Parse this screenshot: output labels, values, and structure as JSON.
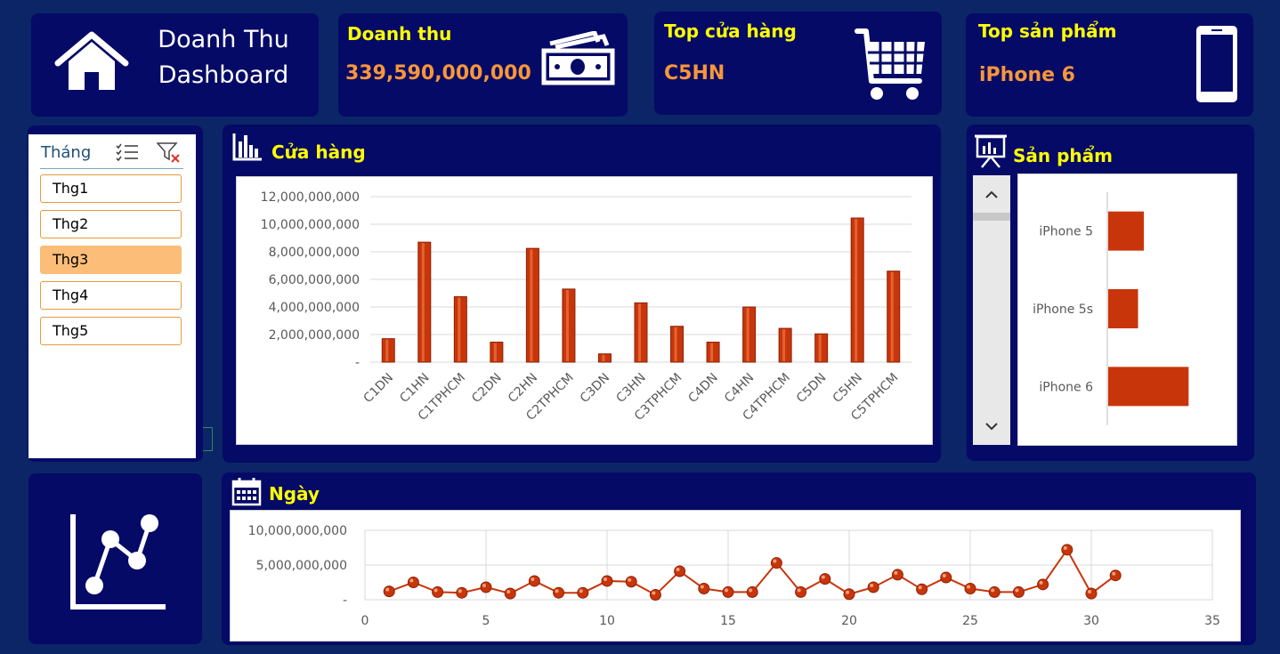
{
  "header": {
    "title_line1": "Doanh Thu",
    "title_line2": "Dashboard"
  },
  "kpis": {
    "revenue": {
      "label": "Doanh thu",
      "value": "339,590,000,000"
    },
    "top_store": {
      "label": "Top cửa hàng",
      "value": "C5HN"
    },
    "top_product": {
      "label": "Top sản phẩm",
      "value": "iPhone 6"
    }
  },
  "slicer": {
    "header": "Tháng",
    "items": [
      {
        "label": "Thg1",
        "selected": false
      },
      {
        "label": "Thg2",
        "selected": false
      },
      {
        "label": "Thg3",
        "selected": true
      },
      {
        "label": "Thg4",
        "selected": false
      },
      {
        "label": "Thg5",
        "selected": false
      }
    ]
  },
  "panels": {
    "store": "Cửa hàng",
    "product": "Sản phẩm",
    "day": "Ngày"
  },
  "colors": {
    "bar": "#c9350a",
    "line": "#c9350a",
    "background": "#0b2566",
    "card": "#050a66",
    "title": "#ffff00",
    "value": "#f7963a"
  },
  "icons": {
    "header": "home-icon",
    "revenue": "money-icon",
    "top_store": "shopping-cart-icon",
    "top_product": "smartphone-icon",
    "store_panel": "bar-chart-icon",
    "product_panel": "presentation-icon",
    "day_panel": "calendar-icon",
    "trend": "line-chart-icon"
  },
  "chart_data": [
    {
      "type": "bar",
      "categories": [
        "C1DN",
        "C1HN",
        "C1TPHCM",
        "C2DN",
        "C2HN",
        "C2TPHCM",
        "C3DN",
        "C3HN",
        "C3TPHCM",
        "C4DN",
        "C4HN",
        "C4TPHCM",
        "C5DN",
        "C5HN",
        "C5TPHCM"
      ],
      "values": [
        1700000000,
        8700000000,
        4750000000,
        1450000000,
        8250000000,
        5300000000,
        600000000,
        4300000000,
        2600000000,
        1450000000,
        4000000000,
        2450000000,
        2050000000,
        10450000000,
        6600000000
      ],
      "ylim": [
        0,
        12000000000
      ],
      "yticks": [
        "-",
        "2,000,000,000",
        "4,000,000,000",
        "6,000,000,000",
        "8,000,000,000",
        "10,000,000,000",
        "12,000,000,000"
      ],
      "grid": true,
      "legend": "none"
    },
    {
      "type": "bar",
      "orientation": "horizontal",
      "categories": [
        "iPhone 5",
        "iPhone 5s",
        "iPhone 6"
      ],
      "values": [
        43,
        36,
        97
      ],
      "xlim": [
        0,
        145
      ],
      "grid": false,
      "legend": "none"
    },
    {
      "type": "line",
      "x": [
        1,
        2,
        3,
        4,
        5,
        6,
        7,
        8,
        9,
        10,
        11,
        12,
        13,
        14,
        15,
        16,
        17,
        18,
        19,
        20,
        21,
        22,
        23,
        24,
        25,
        26,
        27,
        28,
        29,
        30,
        31
      ],
      "values": [
        1200000000,
        2500000000,
        1100000000,
        1000000000,
        1800000000,
        900000000,
        2700000000,
        1000000000,
        1000000000,
        2700000000,
        2600000000,
        700000000,
        4100000000,
        1600000000,
        1100000000,
        1100000000,
        5300000000,
        1100000000,
        3000000000,
        800000000,
        1800000000,
        3600000000,
        1500000000,
        3200000000,
        1600000000,
        1100000000,
        1100000000,
        2200000000,
        7200000000,
        900000000,
        3500000000
      ],
      "xlim": [
        0,
        35
      ],
      "xticks": [
        "0",
        "5",
        "10",
        "15",
        "20",
        "25",
        "30",
        "35"
      ],
      "ylim": [
        0,
        10000000000
      ],
      "yticks": [
        "-",
        "5,000,000,000",
        "10,000,000,000"
      ],
      "grid": true,
      "legend": "none"
    }
  ]
}
